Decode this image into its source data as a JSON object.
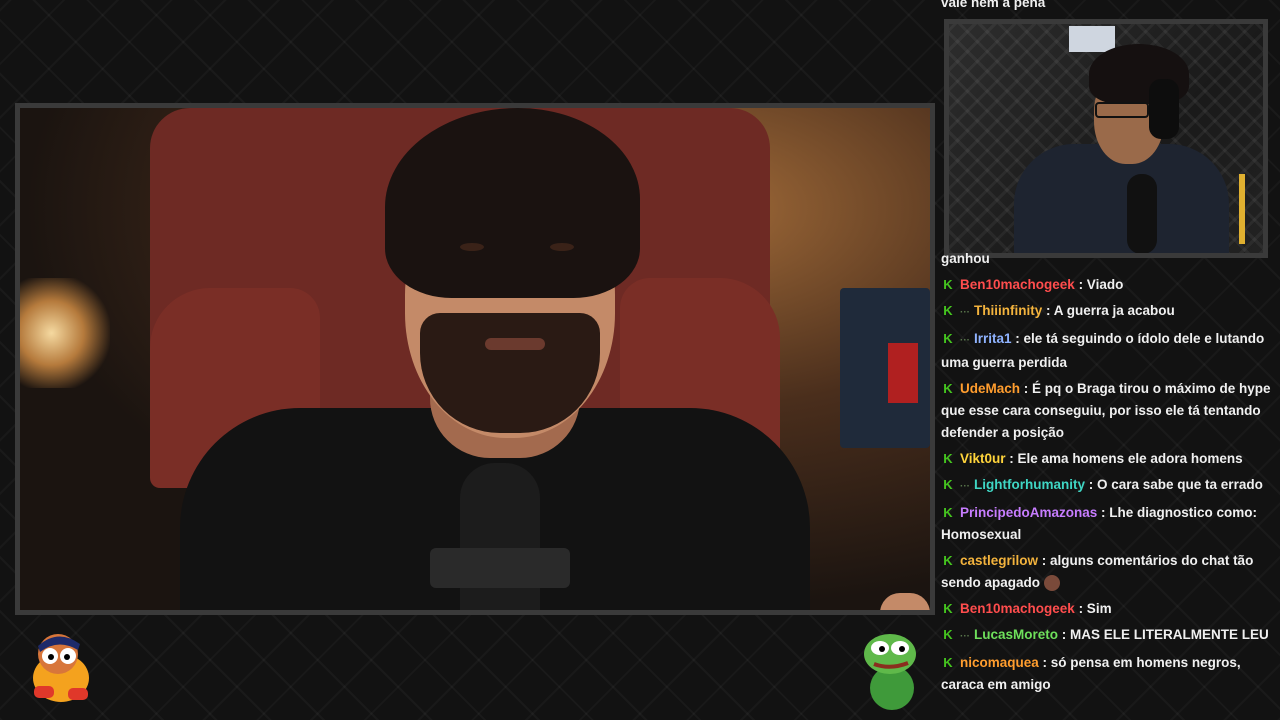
{
  "chat": {
    "top_partial": "vale nem a pena",
    "mid_partial": "ganhou",
    "messages": [
      {
        "user": "Ben10machogeek",
        "user_color": "#ff4d4d",
        "text": "Viado",
        "sub": false
      },
      {
        "user": "Thiiinfinity",
        "user_color": "#f3b33d",
        "text": "A guerra ja acabou",
        "sub": true
      },
      {
        "user": "Irrita1",
        "user_color": "#8fb3ff",
        "text": "ele tá seguindo o ídolo dele e lutando uma guerra perdida",
        "sub": true
      },
      {
        "user": "UdeMach",
        "user_color": "#ff9d2e",
        "text": "É pq o Braga tirou o máximo de hype que esse cara conseguiu, por isso ele tá tentando defender a posição",
        "sub": false
      },
      {
        "user": "Vikt0ur",
        "user_color": "#ffd43b",
        "text": "Ele ama homens ele adora homens",
        "sub": false
      },
      {
        "user": "Lightforhumanity",
        "user_color": "#3fd6c4",
        "text": "O cara sabe que ta errado",
        "sub": true
      },
      {
        "user": "PrincipedoAmazonas",
        "user_color": "#c77dff",
        "text": "Lhe diagnostico como: Homosexual",
        "sub": false
      },
      {
        "user": "castlegrilow",
        "user_color": "#f3b33d",
        "text": "alguns comentários do chat tão sendo apagado",
        "sub": false,
        "emoji": "person-emoji"
      },
      {
        "user": "Ben10machogeek",
        "user_color": "#ff4d4d",
        "text": "Sim",
        "sub": false
      },
      {
        "user": "LucasMoreto",
        "user_color": "#6ee05b",
        "text": "MAS ELE LITERALMENTE LEU",
        "sub": true
      },
      {
        "user": "nicomaquea",
        "user_color": "#ff9d2e",
        "text": "só pensa em homens negros, caraca em amigo",
        "sub": false
      }
    ],
    "badge_icon": "kick-badge-icon",
    "badge_glyph": "K",
    "sub_glyph": "···",
    "separator": " : "
  },
  "colors": {
    "badge": "#45c51f",
    "frame": "#3a3a3a",
    "background": "#121212"
  }
}
